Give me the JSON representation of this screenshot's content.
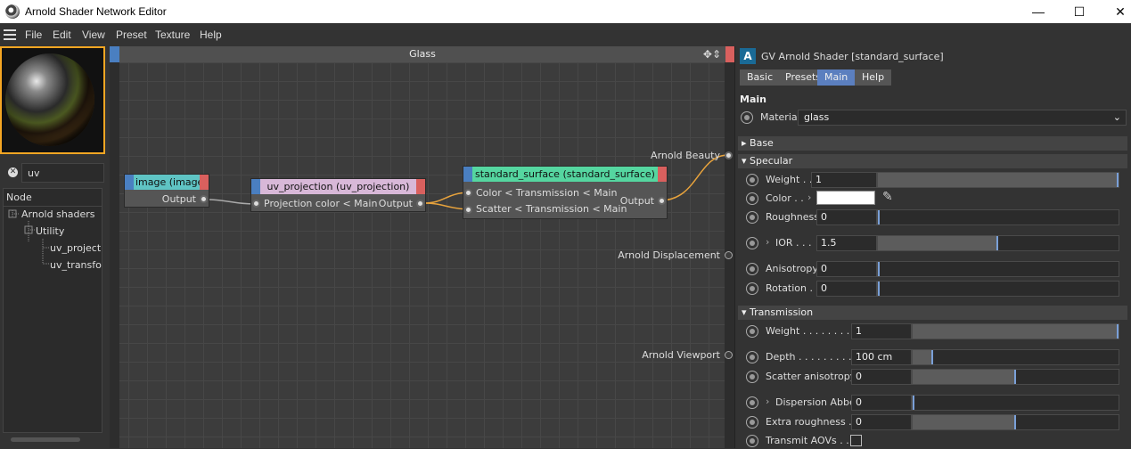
{
  "window": {
    "title": "Arnold Shader Network Editor",
    "controls": [
      "—",
      "☐",
      "✕"
    ]
  },
  "menu": [
    "File",
    "Edit",
    "View",
    "Preset",
    "Texture",
    "Help"
  ],
  "left": {
    "search_value": "uv",
    "tree_header": "Node",
    "tree": [
      "Arnold shaders",
      "Utility",
      "uv_projectio",
      "uv_transforr"
    ]
  },
  "graph": {
    "title": "Glass",
    "nodes": {
      "image": {
        "title": "image (image)",
        "output": "Output"
      },
      "uvproj": {
        "title": "uv_projection (uv_projection)",
        "input": "Projection color < Main",
        "output": "Output"
      },
      "std": {
        "title": "standard_surface (standard_surface)",
        "input1": "Color < Transmission < Main",
        "input2": "Scatter < Transmission < Main",
        "output": "Output"
      }
    },
    "outputs": [
      "Arnold Beauty",
      "Arnold Displacement",
      "Arnold Viewport"
    ]
  },
  "attr": {
    "header": "GV Arnold Shader [standard_surface]",
    "tabs": [
      "Basic",
      "Presets",
      "Main",
      "Help"
    ],
    "active_tab": "Main",
    "section_main": "Main",
    "material_label": "Material",
    "material_value": "glass",
    "groups": {
      "base": "Base",
      "specular": "Specular",
      "transmission": "Transmission"
    },
    "spec": {
      "weight_label": "Weight . .",
      "weight_value": "1",
      "weight_fill": 1.0,
      "color_label": "Color . .",
      "roughness_label": "Roughness",
      "roughness_value": "0",
      "roughness_fill": 0.0,
      "ior_label": "IOR . . .",
      "ior_value": "1.5",
      "ior_fill": 0.5,
      "aniso_label": "Anisotropy",
      "aniso_value": "0",
      "aniso_fill": 0.0,
      "rotation_label": "Rotation .",
      "rotation_value": "0",
      "rotation_fill": 0.0
    },
    "trans": {
      "weight_label": "Weight . . . . . . . .",
      "weight_value": "1",
      "weight_fill": 1.0,
      "depth_label": "Depth . . . . . . . . .",
      "depth_value": "100 cm",
      "depth_fill": 0.1,
      "scatter_label": "Scatter anisotropy",
      "scatter_value": "0",
      "scatter_fill": 0.5,
      "abbe_label": "Dispersion Abbe",
      "abbe_value": "0",
      "abbe_fill": 0.0,
      "extra_label": "Extra roughness . .",
      "extra_value": "0",
      "extra_fill": 0.5,
      "aov_label": "Transmit AOVs . . ."
    }
  },
  "colors": {
    "accent": "#5b7fbf",
    "std_header": "#55d6a0",
    "image_header": "#5fc4c4",
    "uv_header": "#d8b8d8",
    "wire": "#e8a33c"
  }
}
